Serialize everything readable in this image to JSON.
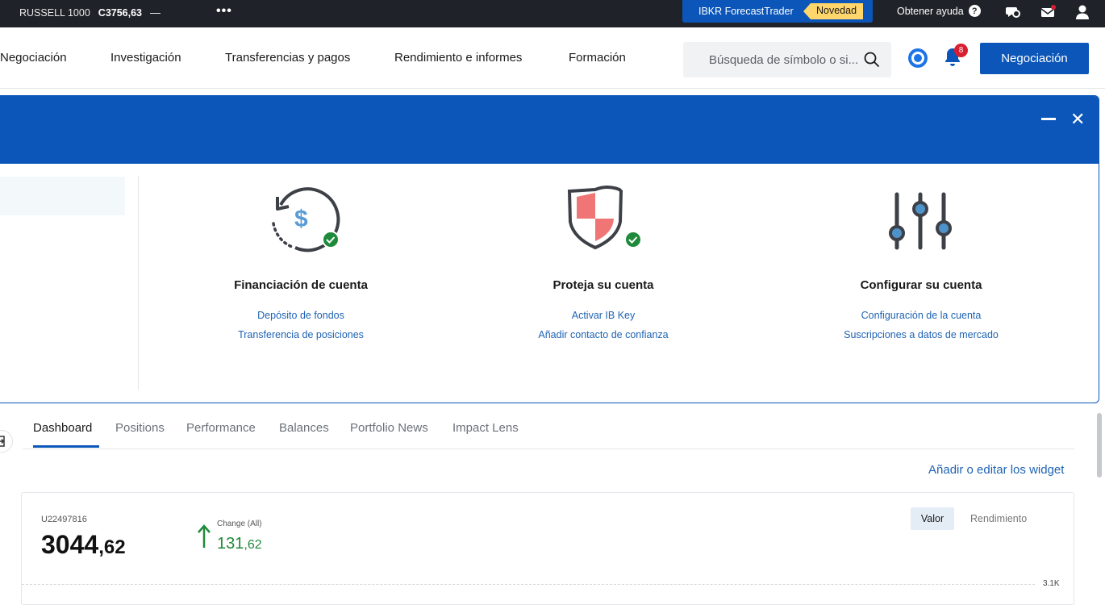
{
  "topbar": {
    "ticker_name": "RUSSELL 1000",
    "ticker_value": "C3756,63",
    "ticker_change": "—",
    "more": "•••",
    "forecast_label": "IBKR ForecastTrader",
    "new_badge": "Novedad",
    "help_label": "Obtener ayuda",
    "help_icon": "?"
  },
  "nav": {
    "items": [
      "Negociación",
      "Investigación",
      "Transferencias y pagos",
      "Rendimiento e informes",
      "Formación"
    ],
    "search_placeholder": "Búsqueda de símbolo o si...",
    "notifications_count": "8",
    "trade_button": "Negociación"
  },
  "onboarding": {
    "cards": [
      {
        "title": "Financiación de cuenta",
        "links": [
          "Depósito de fondos",
          "Transferencia de posiciones"
        ],
        "icon": "dollar-refresh-icon",
        "completed": true
      },
      {
        "title": "Proteja su cuenta",
        "links": [
          "Activar IB Key",
          "Añadir contacto de confianza"
        ],
        "icon": "shield-icon",
        "completed": true
      },
      {
        "title": "Configurar su cuenta",
        "links": [
          "Configuración de la cuenta",
          "Suscripciones a datos de mercado"
        ],
        "icon": "sliders-icon",
        "completed": false
      }
    ]
  },
  "tabs": [
    "Dashboard",
    "Positions",
    "Performance",
    "Balances",
    "Portfolio News",
    "Impact Lens"
  ],
  "active_tab": "Dashboard",
  "widgets_link": "Añadir o editar los widget",
  "summary": {
    "account_id": "U22497816",
    "value_int": "3044",
    "value_dec": ",62",
    "change_label": "Change (All)",
    "change_int": "131",
    "change_dec": ",62",
    "toggle_value": "Valor",
    "toggle_return": "Rendimiento",
    "axis_tick": "3.1K"
  },
  "colors": {
    "brand_blue": "#0b56b8",
    "positive_green": "#1e8a3a",
    "alert_red": "#d81e30",
    "badge_yellow": "#ffd66b"
  }
}
